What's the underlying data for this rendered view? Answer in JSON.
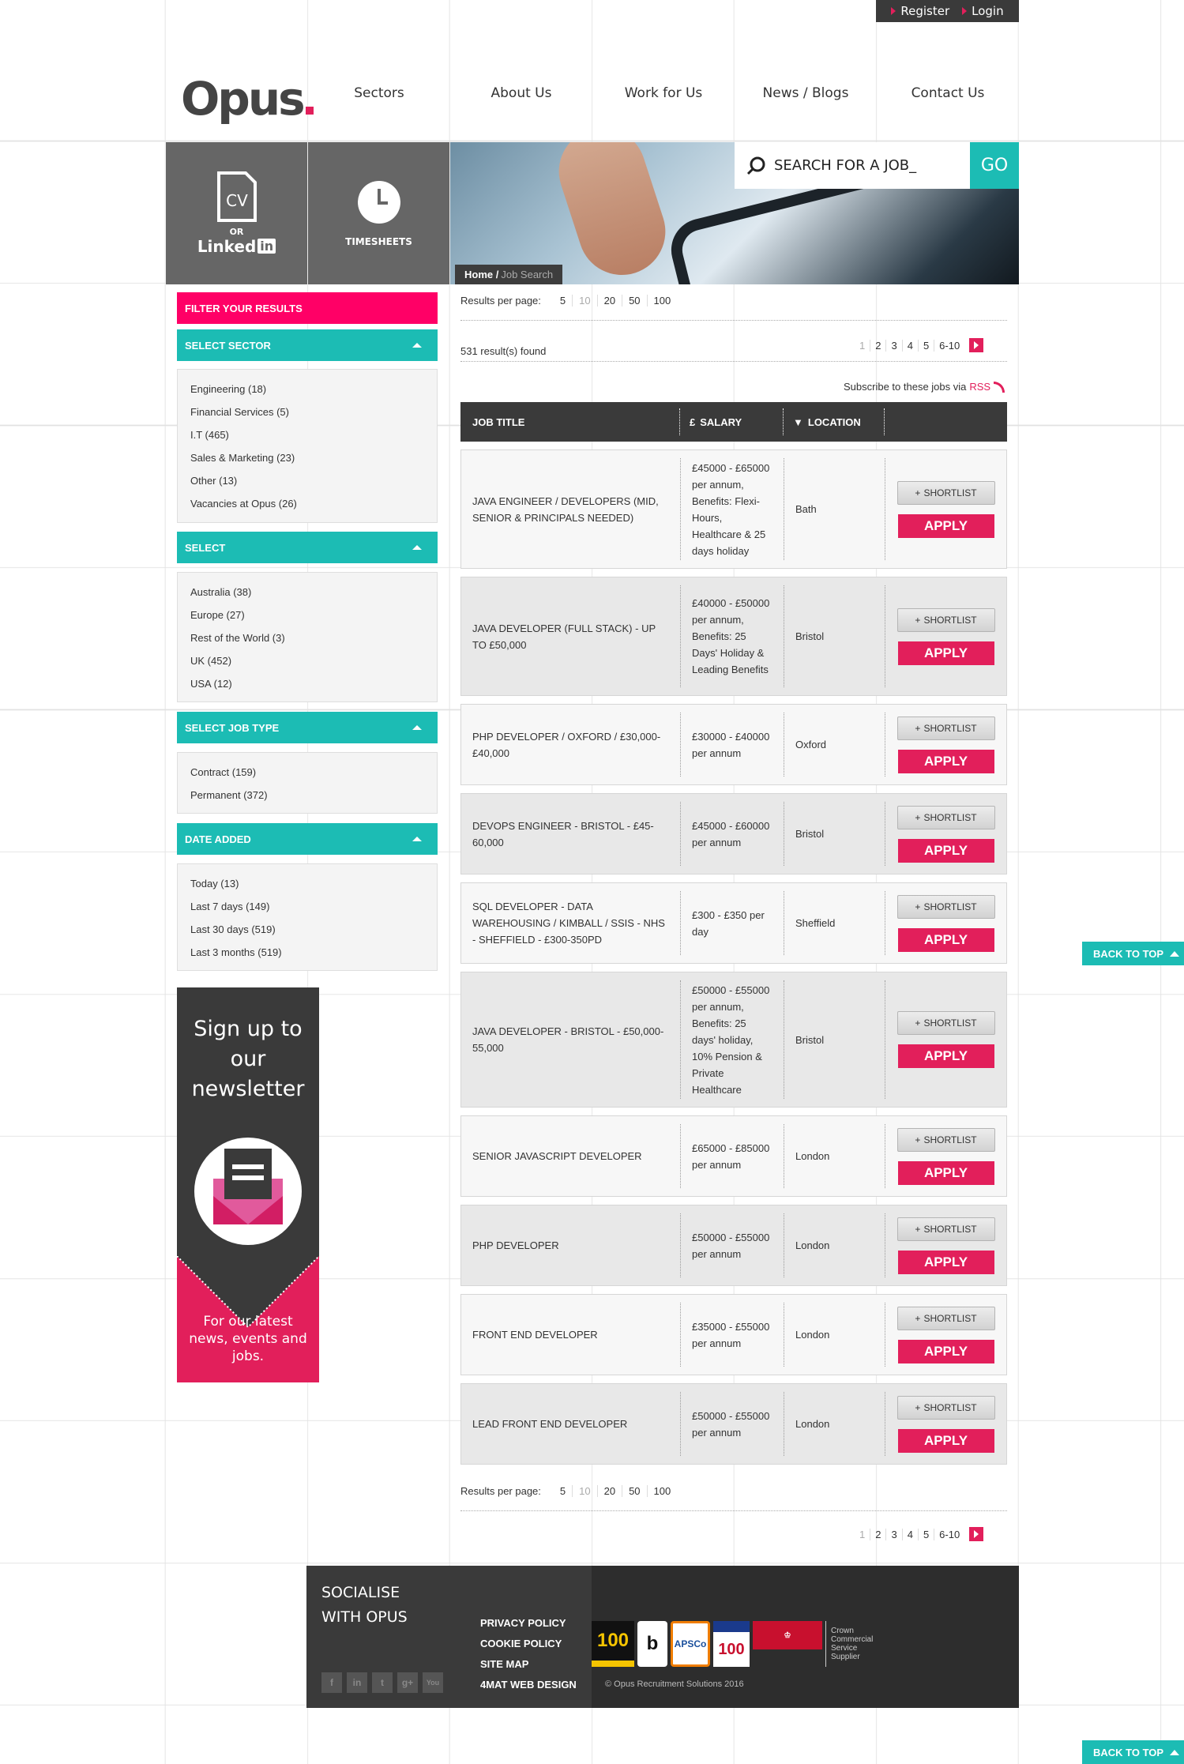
{
  "topbar": {
    "register": "Register",
    "login": "Login"
  },
  "logo": "Opus",
  "nav": [
    "Sectors",
    "About Us",
    "Work for Us",
    "News / Blogs",
    "Contact Us"
  ],
  "hero": {
    "cv": "CV",
    "or": "OR",
    "linkedin": "Linked",
    "in": "in",
    "timesheets": "TIMESHEETS",
    "search_placeholder": "SEARCH FOR A JOB_",
    "go": "GO",
    "breadcrumb": {
      "home": "Home /",
      "current": "Job Search"
    }
  },
  "sidebar": {
    "filter_title": "FILTER YOUR RESULTS",
    "sections": [
      {
        "title": "SELECT SECTOR",
        "items": [
          "Engineering (18)",
          "Financial Services (5)",
          "I.T (465)",
          "Sales & Marketing (23)",
          "Other (13)",
          "Vacancies at Opus (26)"
        ]
      },
      {
        "title": "SELECT",
        "items": [
          "Australia (38)",
          "Europe (27)",
          "Rest of the World (3)",
          "UK (452)",
          "USA (12)"
        ]
      },
      {
        "title": "SELECT JOB TYPE",
        "items": [
          "Contract (159)",
          "Permanent (372)"
        ]
      },
      {
        "title": "DATE ADDED",
        "items": [
          "Today (13)",
          "Last 7 days (149)",
          "Last 30 days (519)",
          "Last 3 months (519)"
        ]
      }
    ],
    "newsletter": {
      "title": "Sign up to our newsletter",
      "footer": "For our latest news, events and jobs."
    }
  },
  "results": {
    "per_page_label": "Results per page:",
    "per_page_options": [
      "5",
      "10",
      "20",
      "50",
      "100"
    ],
    "count_text": "531 result(s) found",
    "pages": [
      "1",
      "2",
      "3",
      "4",
      "5",
      "6-10"
    ],
    "subscribe_text": "Subscribe to these jobs via",
    "rss": "RSS",
    "columns": [
      "JOB TITLE",
      "SALARY",
      "LOCATION"
    ],
    "shortlist_label": "SHORTLIST",
    "apply_label": "APPLY",
    "jobs": [
      {
        "title": "JAVA ENGINEER / DEVELOPERS (MID, SENIOR & PRINCIPALS NEEDED)",
        "salary": "£45000 - £65000 per annum, Benefits: Flexi-Hours, Healthcare & 25 days holiday",
        "location": "Bath"
      },
      {
        "title": "JAVA DEVELOPER (FULL STACK) - UP TO £50,000",
        "salary": "£40000 - £50000 per annum, Benefits: 25 Days' Holiday & Leading Benefits",
        "location": "Bristol"
      },
      {
        "title": "PHP DEVELOPER / OXFORD / £30,000-£40,000",
        "salary": "£30000 - £40000 per annum",
        "location": "Oxford"
      },
      {
        "title": "DEVOPS ENGINEER - BRISTOL - £45-60,000",
        "salary": "£45000 - £60000 per annum",
        "location": "Bristol"
      },
      {
        "title": "SQL DEVELOPER - DATA WAREHOUSING / KIMBALL / SSIS - NHS - SHEFFIELD - £300-350PD",
        "salary": "£300 - £350 per day",
        "location": "Sheffield"
      },
      {
        "title": "JAVA DEVELOPER - BRISTOL - £50,000-55,000",
        "salary": "£50000 - £55000 per annum, Benefits: 25 days' holiday, 10% Pension & Private Healthcare",
        "location": "Bristol"
      },
      {
        "title": "SENIOR JAVASCRIPT DEVELOPER",
        "salary": "£65000 - £85000 per annum",
        "location": "London"
      },
      {
        "title": "PHP DEVELOPER",
        "salary": "£50000 - £55000 per annum",
        "location": "London"
      },
      {
        "title": "FRONT END DEVELOPER",
        "salary": "£35000 - £55000 per annum",
        "location": "London"
      },
      {
        "title": "LEAD FRONT END DEVELOPER",
        "salary": "£50000 - £55000 per annum",
        "location": "London"
      }
    ]
  },
  "back_to_top": "BACK TO TOP",
  "footer": {
    "socialise": "SOCIALISE WITH OPUS",
    "social_icons": [
      "f",
      "in",
      "t",
      "g+",
      "You"
    ],
    "links": [
      "PRIVACY POLICY",
      "COOKIE POLICY",
      "SITE MAP",
      "4MAT WEB DESIGN"
    ],
    "logos": {
      "sunday_times": "100",
      "b": "b",
      "apsco": "APSCo",
      "fast_track": "100",
      "crown": "Crown Commercial Service Supplier"
    },
    "copyright": "© Opus Recruitment Solutions 2016"
  },
  "colors": {
    "accent_pink": "#e21f5b",
    "filter_pink": "#ff0066",
    "teal": "#1cbcb4",
    "dark": "#3a3a3a"
  }
}
